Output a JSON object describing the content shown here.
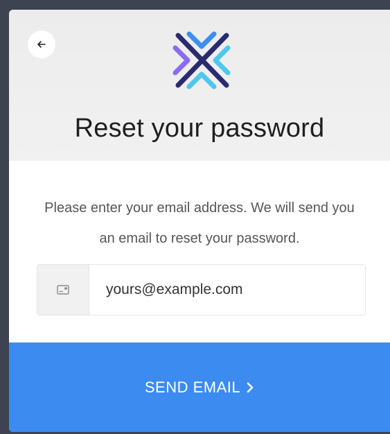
{
  "header": {
    "title": "Reset your password",
    "back_icon": "arrow-left-icon",
    "logo_icon": "x-chevrons-logo"
  },
  "form": {
    "description": "Please enter your email address. We will send you an email to reset your password.",
    "email_placeholder": "yours@example.com",
    "email_value": "",
    "email_icon": "envelope-icon"
  },
  "actions": {
    "send_label": "SEND EMAIL",
    "send_icon": "chevron-right-icon"
  },
  "colors": {
    "background": "#3d4350",
    "header_bg": "#ececec",
    "primary": "#3b8bf0",
    "logo_dark": "#2a2a6e",
    "logo_blue": "#3d8ef0",
    "logo_purple": "#8a6cf0",
    "logo_cyan": "#4fc7ec"
  }
}
